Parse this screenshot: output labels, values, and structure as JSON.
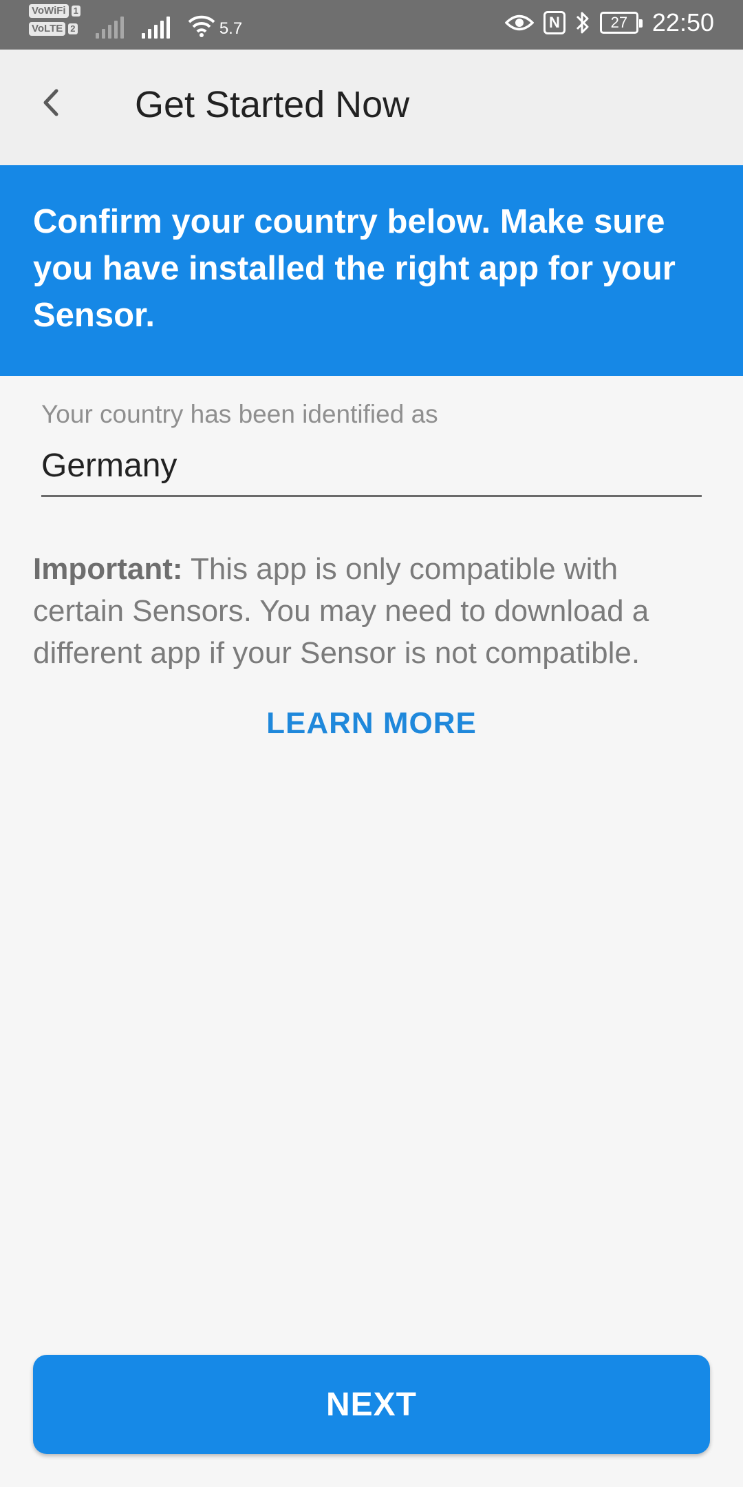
{
  "status_bar": {
    "vowifi_label": "VoWiFi",
    "volte_label": "VoLTE",
    "sim1": "1",
    "sim2": "2",
    "wifi_speed": "5.7",
    "nfc_label": "N",
    "battery_level": "27",
    "time": "22:50"
  },
  "app_bar": {
    "title": "Get Started Now"
  },
  "banner": {
    "text": "Confirm your country below. Make sure you have installed the right app for your Sensor."
  },
  "country_field": {
    "label": "Your country has been identified as",
    "value": "Germany"
  },
  "note": {
    "prefix": "Important:",
    "text": " This app is only compatible with certain Sensors. You may need to download a different app if your Sensor is not compatible."
  },
  "learn_more_label": "LEARN MORE",
  "next_label": "NEXT",
  "colors": {
    "accent": "#1688e6",
    "status_bar": "#6f6f6f",
    "app_bar": "#efefef",
    "background": "#f6f6f6"
  },
  "icons": [
    "back-arrow-icon",
    "eye-icon",
    "nfc-icon",
    "bluetooth-icon",
    "battery-icon",
    "wifi-icon",
    "signal-icon"
  ]
}
